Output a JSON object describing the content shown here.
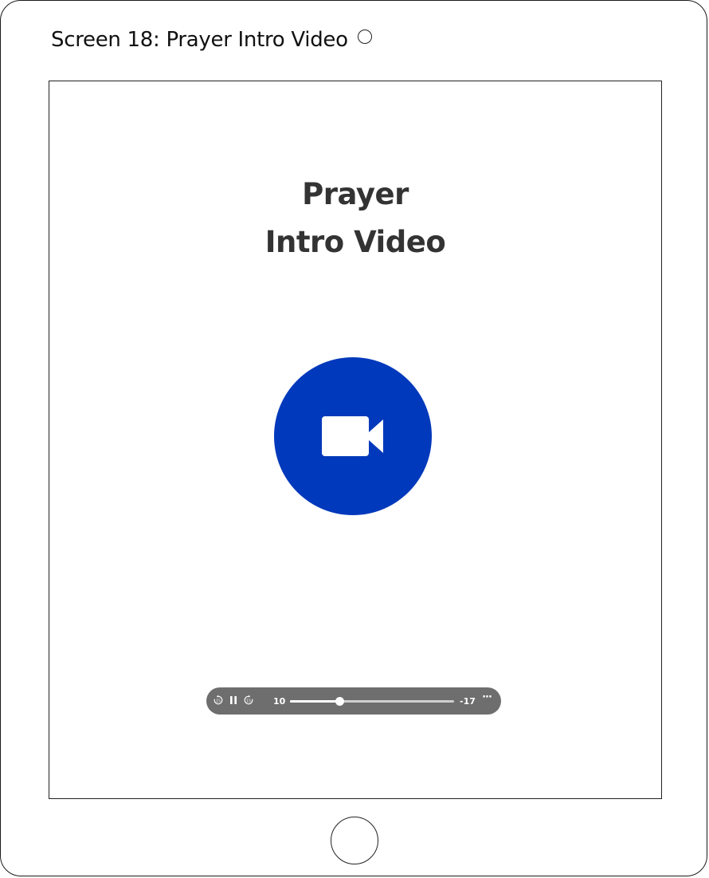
{
  "screen": {
    "title": "Screen 18: Prayer Intro Video"
  },
  "content": {
    "title_line1": "Prayer",
    "title_line2": "Intro Video",
    "video_icon": "video-camera-icon",
    "accent_color": "#0039bb"
  },
  "player": {
    "elapsed": "10",
    "remaining": "-17",
    "progress_fraction": 0.3,
    "rewind_icon": "rewind-15-icon",
    "pause_icon": "pause-icon",
    "forward_icon": "forward-15-icon",
    "more_icon": "more-options-icon",
    "bar_color": "#6e6e6e"
  },
  "device": {
    "home_icon": "home-button"
  }
}
